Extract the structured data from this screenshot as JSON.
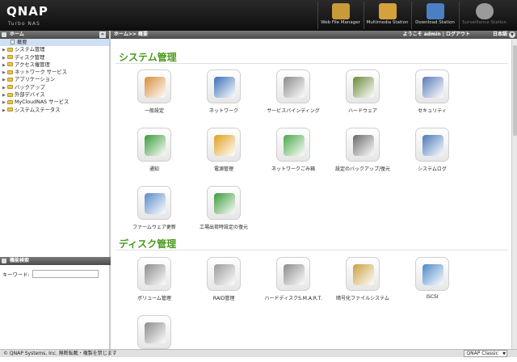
{
  "topbar": {
    "logo": "QNAP",
    "logo_sub": "Turbo NAS",
    "apps": [
      {
        "label": "Web File Manager",
        "icon": "web-file-manager-icon",
        "color": "#c89a3a"
      },
      {
        "label": "Multimedia Station",
        "icon": "multimedia-station-icon",
        "color": "#d6a13c"
      },
      {
        "label": "Download Station",
        "icon": "download-station-icon",
        "color": "#4a7fc4"
      },
      {
        "label": "Surveillance Station",
        "icon": "surveillance-station-icon",
        "color": "#9a9a9a"
      }
    ]
  },
  "sidebar": {
    "header": "ホーム",
    "collapse": "«",
    "items": [
      {
        "label": "概要",
        "selected": true
      },
      {
        "label": "システム管理"
      },
      {
        "label": "ディスク管理"
      },
      {
        "label": "アクセス権管理"
      },
      {
        "label": "ネットワーク サービス"
      },
      {
        "label": "アプリケーション"
      },
      {
        "label": "バックアップ"
      },
      {
        "label": "外部デバイス"
      },
      {
        "label": "MyCloudNAS サービス"
      },
      {
        "label": "システムステータス"
      }
    ]
  },
  "search": {
    "header": "機能検索",
    "label": "キーワード:",
    "value": ""
  },
  "main": {
    "breadcrumb": "ホーム>> 概要",
    "welcome": "ようこそ admin | ログアウト",
    "language": "日本語",
    "sections": [
      {
        "title": "システム管理",
        "items": [
          {
            "label": "一般設定",
            "icon": "general-settings-icon",
            "color": "#d98c3a"
          },
          {
            "label": "ネットワーク",
            "icon": "network-icon",
            "color": "#3b6fb8"
          },
          {
            "label": "サービスバインディング",
            "icon": "service-binding-icon",
            "color": "#8a8a8a"
          },
          {
            "label": "ハードウェア",
            "icon": "hardware-icon",
            "color": "#6b8a3a"
          },
          {
            "label": "セキュリティ",
            "icon": "security-icon",
            "color": "#5a7bb8"
          },
          {
            "label": "通知",
            "icon": "notification-icon",
            "color": "#3a9a3a"
          },
          {
            "label": "電源管理",
            "icon": "power-management-icon",
            "color": "#e0a020"
          },
          {
            "label": "ネットワークごみ箱",
            "icon": "network-recycle-bin-icon",
            "color": "#4aa84a"
          },
          {
            "label": "設定のバックアップ/復元",
            "icon": "backup-restore-settings-icon",
            "color": "#6a6a6a"
          },
          {
            "label": "システムログ",
            "icon": "system-log-icon",
            "color": "#4a78b8"
          },
          {
            "label": "ファームウェア更新",
            "icon": "firmware-update-icon",
            "color": "#5a8ac8"
          },
          {
            "label": "工場出荷時設定の復元",
            "icon": "factory-reset-icon",
            "color": "#3a9a3a"
          }
        ]
      },
      {
        "title": "ディスク管理",
        "items": [
          {
            "label": "ボリューム管理",
            "icon": "volume-management-icon",
            "color": "#8a8a8a"
          },
          {
            "label": "RAID管理",
            "icon": "raid-management-icon",
            "color": "#9a9a9a"
          },
          {
            "label": "ハードディスクS.M.A.R.T.",
            "icon": "hdd-smart-icon",
            "color": "#8a8a8a"
          },
          {
            "label": "暗号化ファイルシステム",
            "icon": "encrypted-fs-icon",
            "color": "#c8a040"
          },
          {
            "label": "iSCSI",
            "icon": "iscsi-icon",
            "color": "#4a88c8"
          },
          {
            "label": "",
            "icon": "virtual-disk-icon",
            "color": "#8a8a8a"
          }
        ]
      }
    ]
  },
  "status": {
    "copyright": "© QNAP Systems, Inc. 無断転載・複製を禁じます",
    "theme": "QNAP Classic"
  }
}
